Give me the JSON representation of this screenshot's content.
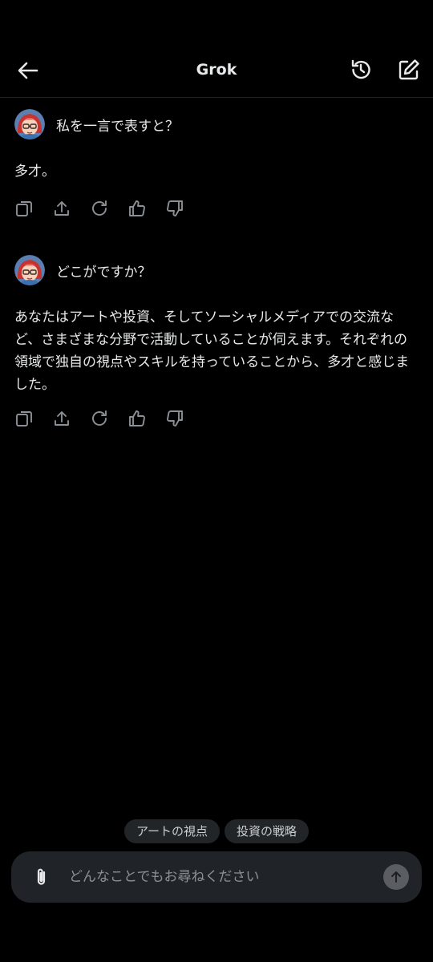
{
  "header": {
    "title": "Grok",
    "back_icon": "arrow-left-icon",
    "history_icon": "history-icon",
    "compose_icon": "compose-icon"
  },
  "messages": [
    {
      "user_text": "私を一言で表すと？",
      "reply": "多才。"
    },
    {
      "user_text": "どこがですか？",
      "reply": "あなたはアートや投資、そしてソーシャルメディアでの交流など、さまざまな分野で活動していることが伺えます。それぞれの領域で独自の視点やスキルを持っていることから、多才と感じました。"
    }
  ],
  "action_icons": [
    "copy-icon",
    "share-icon",
    "regenerate-icon",
    "thumbs-up-icon",
    "thumbs-down-icon"
  ],
  "suggestions": [
    "アートの視点",
    "投資の戦略"
  ],
  "composer": {
    "placeholder": "どんなことでもお尋ねください",
    "attach_icon": "paperclip-icon",
    "send_icon": "arrow-up-icon"
  },
  "colors": {
    "background": "#000000",
    "text": "#e7e9ea",
    "muted": "#8b9096",
    "chip_bg": "#222528",
    "composer_bg": "#202327"
  }
}
